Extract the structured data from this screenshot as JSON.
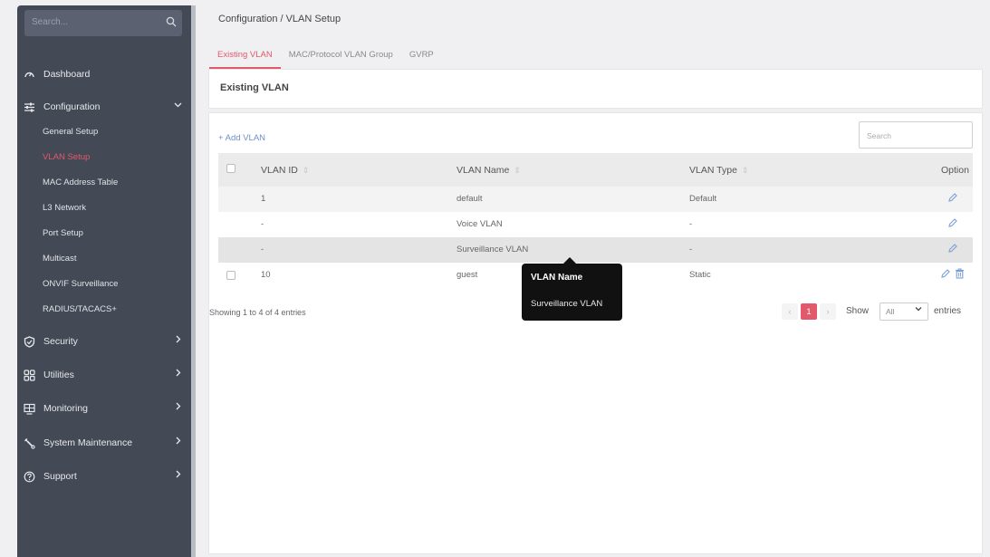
{
  "sidebar": {
    "search_placeholder": "Search...",
    "items": [
      {
        "label": "Dashboard",
        "icon": "dashboard-icon"
      },
      {
        "label": "Configuration",
        "icon": "sliders-icon",
        "expanded": true
      },
      {
        "label": "Security",
        "icon": "shield-icon"
      },
      {
        "label": "Utilities",
        "icon": "grid-icon"
      },
      {
        "label": "Monitoring",
        "icon": "monitor-icon"
      },
      {
        "label": "System Maintenance",
        "icon": "wrench-icon"
      },
      {
        "label": "Support",
        "icon": "help-icon"
      }
    ],
    "config_sub": [
      "General Setup",
      "VLAN Setup",
      "MAC Address Table",
      "L3 Network",
      "Port Setup",
      "Multicast",
      "ONVIF Surveillance",
      "RADIUS/TACACS+"
    ],
    "active_sub": "VLAN Setup"
  },
  "breadcrumb": "Configuration / VLAN Setup",
  "tabs": [
    "Existing VLAN",
    "MAC/Protocol VLAN Group",
    "GVRP"
  ],
  "active_tab": "Existing VLAN",
  "card_title": "Existing VLAN",
  "add_button": "+ Add VLAN",
  "table_search_placeholder": "Search",
  "table": {
    "headers": [
      "VLAN ID",
      "VLAN Name",
      "VLAN Type",
      "Option"
    ],
    "rows": [
      {
        "id": "1",
        "name": "default",
        "type": "Default"
      },
      {
        "id": "-",
        "name": "Voice VLAN",
        "type": "-"
      },
      {
        "id": "-",
        "name": "Surveillance VLAN",
        "type": "-"
      },
      {
        "id": "10",
        "name": "guest",
        "type": "Static"
      }
    ]
  },
  "footer": {
    "info": "Showing 1 to 4 of 4 entries",
    "prev": "‹",
    "page": "1",
    "next": "›",
    "show_label": "Show",
    "show_value": "All",
    "entries_label": "entries"
  },
  "tooltip": {
    "title": "VLAN Name",
    "value": "Surveillance VLAN"
  },
  "colors": {
    "accent": "#e2596b",
    "sidebar_bg": "#434955",
    "link": "#6d90c8"
  }
}
